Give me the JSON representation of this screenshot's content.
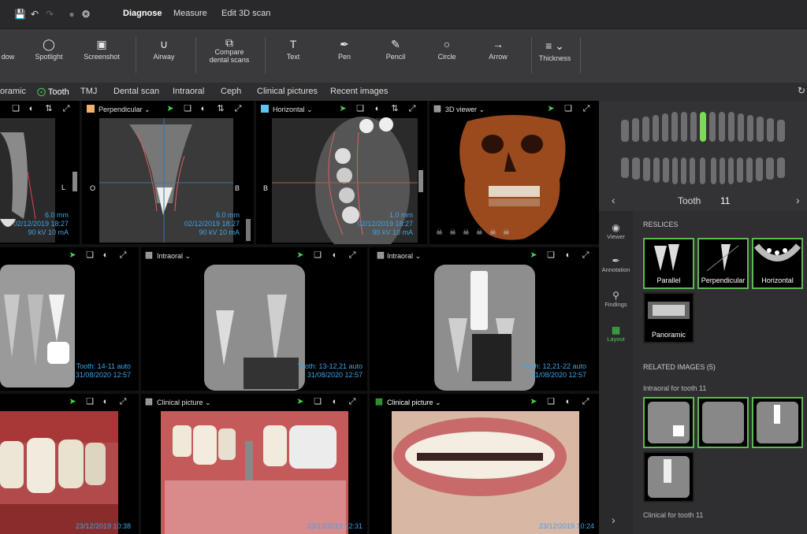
{
  "menubar": {
    "items": [
      "Diagnose",
      "Measure",
      "Edit 3D scan"
    ]
  },
  "toolbar": {
    "tools": [
      "dow",
      "Spotlight",
      "Screenshot",
      "Airway",
      "Compare\ndental scans",
      "Text",
      "Pen",
      "Pencil",
      "Circle",
      "Arrow",
      "Thickness"
    ]
  },
  "tabs": [
    "oramic",
    "Tooth",
    "TMJ",
    "Dental scan",
    "Intraoral",
    "Ceph",
    "Clinical pictures",
    "Recent images"
  ],
  "viewports": {
    "v1": {
      "meta1": "6.0 mm",
      "meta2": "02/12/2019 18:27",
      "meta3": "90 kV  10 mA",
      "letter": "L"
    },
    "v2": {
      "label": "Perpendicular",
      "meta1": "6.0 mm",
      "meta2": "02/12/2019 18:27",
      "meta3": "90 kV  10 mA",
      "left": "O",
      "right": "B"
    },
    "v3": {
      "label": "Horizontal",
      "meta1": "1.0 mm",
      "meta2": "02/12/2019 18:27",
      "meta3": "90 kV  10 mA",
      "left": "B"
    },
    "v4": {
      "label": "3D viewer"
    },
    "v5": {
      "meta1": "Tooth: 14-11  auto",
      "meta2": "31/08/2020 12:57"
    },
    "v6": {
      "label": "Intraoral",
      "meta1": "Tooth: 13-12,21  auto",
      "meta2": "31/08/2020 12:57"
    },
    "v7": {
      "label": "Intraoral",
      "meta1": "Tooth: 12,21-22  auto",
      "meta2": "31/08/2020 12:57"
    },
    "v8": {
      "meta1": "23/12/2019 10:38"
    },
    "v9": {
      "label": "Clinical picture",
      "meta1": "23/12/2019 12:31"
    },
    "v10": {
      "label": "Clinical picture",
      "meta1": "23/12/2019 10:24"
    }
  },
  "panel": {
    "tooth_label": "Tooth",
    "tooth_number": "11",
    "side": [
      "Viewer",
      "Annotation",
      "Findings",
      "Layout"
    ],
    "reslices_title": "RESLICES",
    "reslices": [
      "Parallel",
      "Perpendicular",
      "Horizontal",
      "Panoramic"
    ],
    "related_title": "RELATED IMAGES (5)",
    "intraoral_title": "Intraoral for tooth 11",
    "clinical_title": "Clinical for tooth 11"
  },
  "colors": {
    "accent": "#45d24b",
    "overlay": "#3fa3e6",
    "thumb_border": "#5fb854"
  }
}
